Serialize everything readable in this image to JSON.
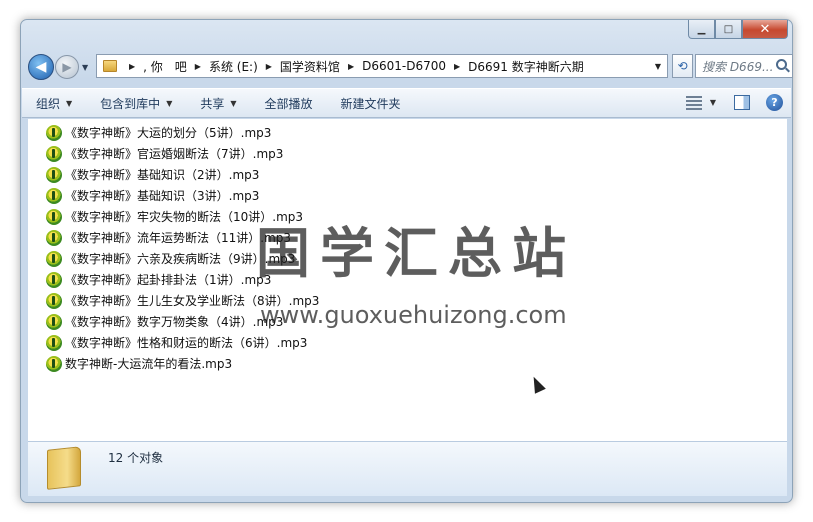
{
  "window": {
    "caption": {
      "minimize": "▁",
      "maximize": "□",
      "close": "✕"
    }
  },
  "nav": {
    "back_glyph": "◀",
    "forward_glyph": "▶",
    "breadcrumbs": [
      ", 你　吧",
      "系统 (E:)",
      "国学资料馆",
      "D6601-D6700",
      "D6691 数字神断六期"
    ],
    "search_placeholder": "搜索 D669...",
    "refresh_glyph": "⟲"
  },
  "toolbar": {
    "organize": "组织",
    "include_library": "包含到库中",
    "share": "共享",
    "play_all": "全部播放",
    "new_folder": "新建文件夹",
    "help": "?"
  },
  "files": [
    "《数字神断》大运的划分（5讲）.mp3",
    "《数字神断》官运婚姻断法（7讲）.mp3",
    "《数字神断》基础知识（2讲）.mp3",
    "《数字神断》基础知识（3讲）.mp3",
    "《数字神断》牢灾失物的断法（10讲）.mp3",
    "《数字神断》流年运势断法（11讲）.mp3",
    "《数字神断》六亲及疾病断法（9讲）.mp3",
    "《数字神断》起卦排卦法（1讲）.mp3",
    "《数字神断》生儿生女及学业断法（8讲）.mp3",
    "《数字神断》数字万物类象（4讲）.mp3",
    "《数字神断》性格和财运的断法（6讲）.mp3",
    "数字神断-大运流年的看法.mp3"
  ],
  "watermark": {
    "cn": "国学汇总站",
    "url": "www.guoxuehuizong.com"
  },
  "details": {
    "count": "12 个对象"
  }
}
